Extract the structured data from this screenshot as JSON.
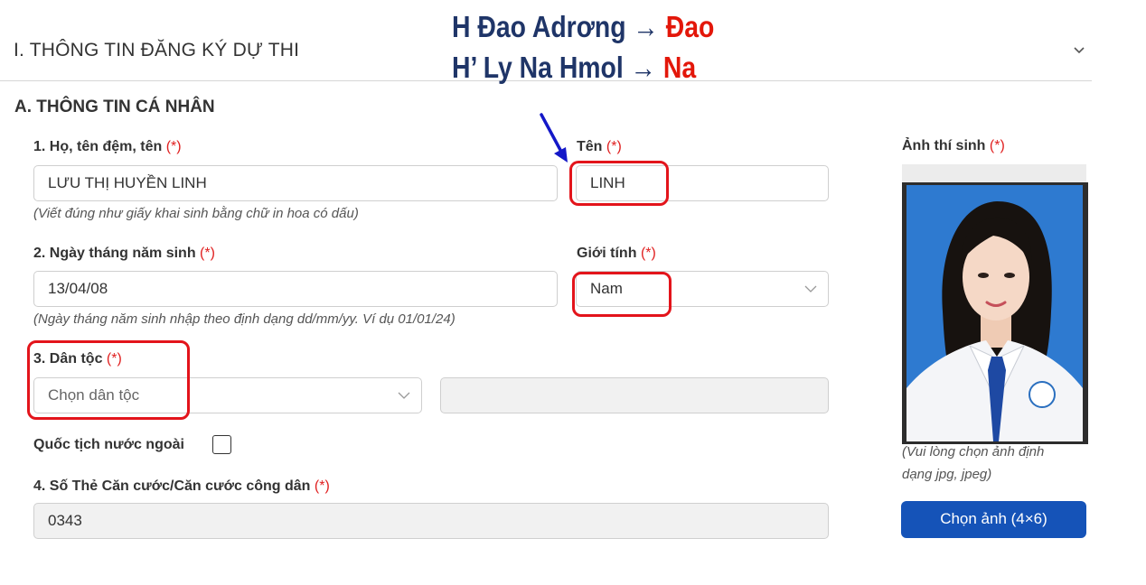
{
  "section": {
    "title": "I. THÔNG TIN ĐĂNG KÝ DỰ THI"
  },
  "annotation": {
    "line1_prefix": "H Đao Adrơng → ",
    "line1_highlight": "Đao",
    "line2_prefix": "H’ Ly Na Hmol → ",
    "line2_highlight": "Na"
  },
  "subsection": {
    "title": "A. THÔNG TIN CÁ NHÂN"
  },
  "form": {
    "required_mark": "(*)",
    "full_name": {
      "label": "1. Họ, tên đệm, tên",
      "value": "LƯU THỊ HUYỀN LINH",
      "hint": "(Viết đúng như giấy khai sinh bằng chữ in hoa có dấu)"
    },
    "given_name": {
      "label": "Tên",
      "value": "LINH"
    },
    "birth_date": {
      "label": "2. Ngày tháng năm sinh",
      "value": "13/04/08",
      "hint": "(Ngày tháng năm sinh nhập theo định dạng dd/mm/yy. Ví dụ 01/01/24)"
    },
    "gender": {
      "label": "Giới tính",
      "value": "Nam"
    },
    "ethnicity": {
      "label": "3. Dân tộc",
      "placeholder": "Chọn dân tộc",
      "other_value": ""
    },
    "foreign_nationality": {
      "label": "Quốc tịch nước ngoài",
      "checked": false
    },
    "id_card": {
      "label": "4. Số Thẻ Căn cước/Căn cước công dân",
      "value": "0343"
    }
  },
  "photo": {
    "label": "Ảnh thí sinh",
    "hint_line1": "(Vui lòng chọn ảnh định",
    "hint_line2": "dạng jpg, jpeg)",
    "button_label": "Chọn ảnh (4×6)"
  },
  "colors": {
    "highlight": "#e3141b",
    "arrow": "#1418c8",
    "annotation_text": "#1f3568",
    "annotation_highlight": "#e3170a",
    "button": "#1553b8",
    "photo_background": "#2e7ad0"
  }
}
